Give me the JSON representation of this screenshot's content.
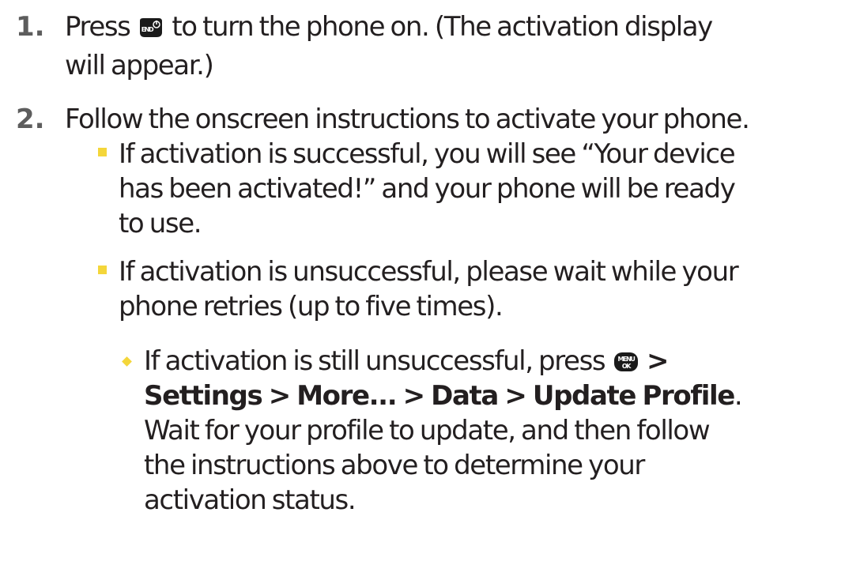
{
  "steps": [
    {
      "number": "1.",
      "line1_before": "Press",
      "key": "END",
      "line1_after": "to turn the phone on. (The activation display",
      "line2": "will appear.)"
    },
    {
      "number": "2.",
      "line1": "Follow the onscreen instructions to activate your phone.",
      "bullets": [
        {
          "lines": [
            "If activation is successful, you will see “Your device",
            "has been activated!” and your phone will be ready",
            "to use."
          ]
        },
        {
          "lines": [
            "If activation is unsuccessful, please wait while your",
            "phone retries (up to five times)."
          ],
          "sub": {
            "line1_before": "If activation is still unsuccessful, press",
            "key_top": "MENU",
            "key_bottom": "OK",
            "arrow": ">",
            "path": "Settings > More... > Data > Update Profile",
            "path_end": ".",
            "lines": [
              "Wait for your profile to update, and then follow",
              "the instructions above to determine your",
              "activation status."
            ]
          }
        }
      ]
    }
  ],
  "colors": {
    "text": "#231f20",
    "number": "#5d5d5d",
    "bullet": "#f4d63a",
    "key_bg": "#1a1a1a"
  }
}
